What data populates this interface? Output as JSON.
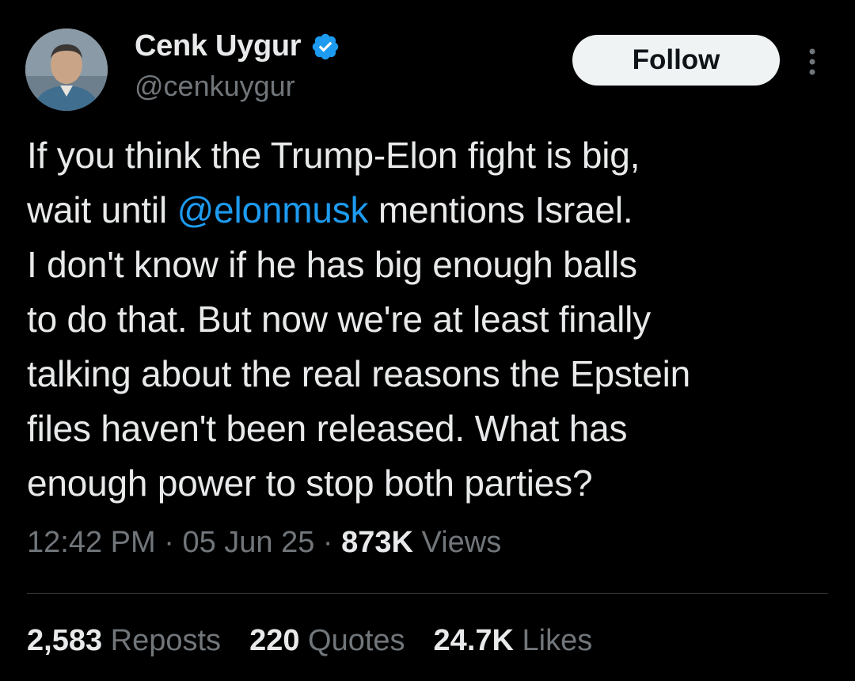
{
  "author": {
    "display_name": "Cenk Uygur",
    "handle": "@cenkuygur",
    "verified": true
  },
  "follow_label": "Follow",
  "tweet": {
    "text_before": "If you think the Trump-Elon fight is big,\nwait until ",
    "mention": "@elonmusk",
    "text_after": " mentions Israel.\nI don't know if he has big enough balls\nto do that. But now we're at least finally\ntalking about the real reasons the Epstein\nfiles haven't been released. What has\nenough power to stop both parties?"
  },
  "meta": {
    "time": "12:42 PM",
    "separator": " · ",
    "date": "05 Jun 25",
    "views_count": "873K",
    "views_label": " Views"
  },
  "stats": {
    "reposts_count": "2,583",
    "reposts_label": " Reposts",
    "quotes_count": "220",
    "quotes_label": " Quotes",
    "likes_count": "24.7K",
    "likes_label": " Likes"
  },
  "colors": {
    "background": "#000000",
    "text": "#e7e9ea",
    "secondary": "#71767b",
    "accent": "#1d9bf0"
  }
}
